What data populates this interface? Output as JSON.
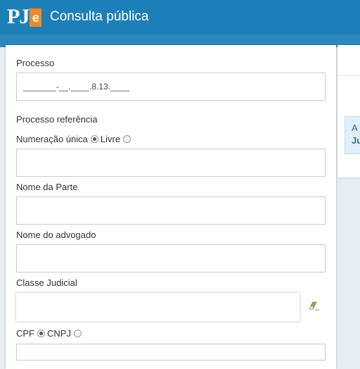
{
  "header": {
    "logo_text": "PJ",
    "logo_badge": "e",
    "title": "Consulta pública"
  },
  "side": {
    "alert_line1": "A",
    "alert_line2": "Ju"
  },
  "form": {
    "processo_label": "Processo",
    "processo_value": "_______-__.____.8.13.____",
    "referencia_label": "Processo referência",
    "numeracao_unica_label": "Numeração única",
    "livre_label": "Livre",
    "referencia_value": "",
    "nome_parte_label": "Nome da Parte",
    "nome_parte_value": "",
    "nome_advogado_label": "Nome do advogado",
    "nome_advogado_value": "",
    "classe_label": "Classe Judicial",
    "classe_value": "",
    "cpf_label": "CPF",
    "cnpj_label": "CNPJ",
    "doc_value": ""
  },
  "icons": {
    "clear": "eraser-icon"
  }
}
